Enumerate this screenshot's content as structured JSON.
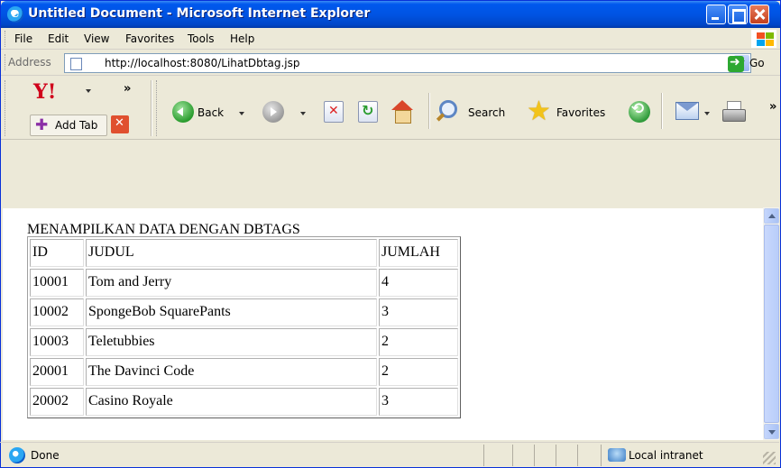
{
  "window": {
    "title": "Untitled Document - Microsoft Internet Explorer"
  },
  "menu": {
    "items": [
      "File",
      "Edit",
      "View",
      "Favorites",
      "Tools",
      "Help"
    ]
  },
  "address_bar": {
    "label": "Address",
    "url": "http://localhost:8080/LihatDbtag.jsp",
    "go_label": "Go"
  },
  "toolbar": {
    "yahoo_logo": "Y!",
    "add_tab_label": "Add Tab",
    "back_label": "Back",
    "search_label": "Search",
    "favorites_label": "Favorites"
  },
  "page": {
    "heading": "MENAMPILKAN DATA DENGAN DBTAGS",
    "table": {
      "headers": [
        "ID",
        "JUDUL",
        "JUMLAH"
      ],
      "rows": [
        [
          "10001",
          "Tom and Jerry",
          "4"
        ],
        [
          "10002",
          "SpongeBob SquarePants",
          "3"
        ],
        [
          "10003",
          "Teletubbies",
          "2"
        ],
        [
          "20001",
          "The Davinci Code",
          "2"
        ],
        [
          "20002",
          "Casino Royale",
          "3"
        ]
      ]
    }
  },
  "status_bar": {
    "status_text": "Done",
    "zone_text": "Local intranet"
  },
  "colors": {
    "title_bar": "#0054e3",
    "window_face": "#ece9d8",
    "scrollbar_thumb": "#c1d3fb"
  }
}
